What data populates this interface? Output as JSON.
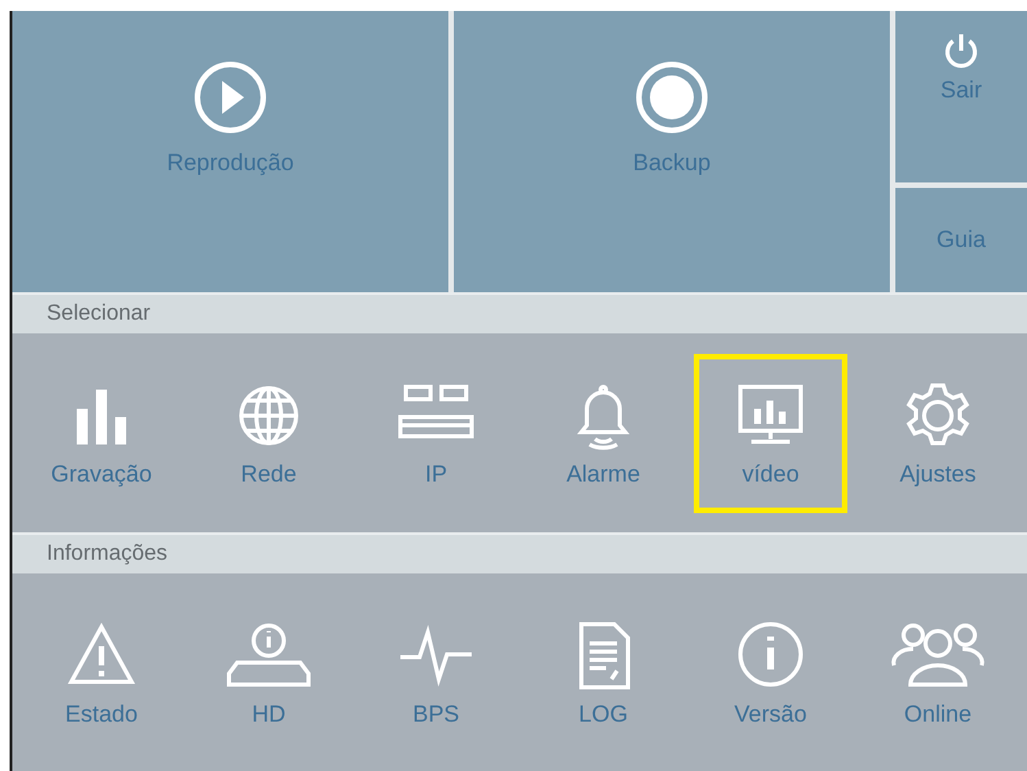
{
  "tiles": [
    {
      "label": "Reprodução"
    },
    {
      "label": "Backup"
    },
    {
      "label": "Sair"
    },
    {
      "label": "Guia"
    }
  ],
  "sections": [
    {
      "title": "Selecionar",
      "items": [
        {
          "label": "Gravação",
          "selected": false
        },
        {
          "label": "Rede",
          "selected": false
        },
        {
          "label": "IP",
          "selected": false
        },
        {
          "label": "Alarme",
          "selected": false
        },
        {
          "label": "vídeo",
          "selected": true
        },
        {
          "label": "Ajustes",
          "selected": false
        }
      ]
    },
    {
      "title": "Informações",
      "items": [
        {
          "label": "Estado",
          "selected": false
        },
        {
          "label": "HD",
          "selected": false
        },
        {
          "label": "BPS",
          "selected": false
        },
        {
          "label": "LOG",
          "selected": false
        },
        {
          "label": "Versão",
          "selected": false
        },
        {
          "label": "Online",
          "selected": false
        }
      ]
    }
  ]
}
